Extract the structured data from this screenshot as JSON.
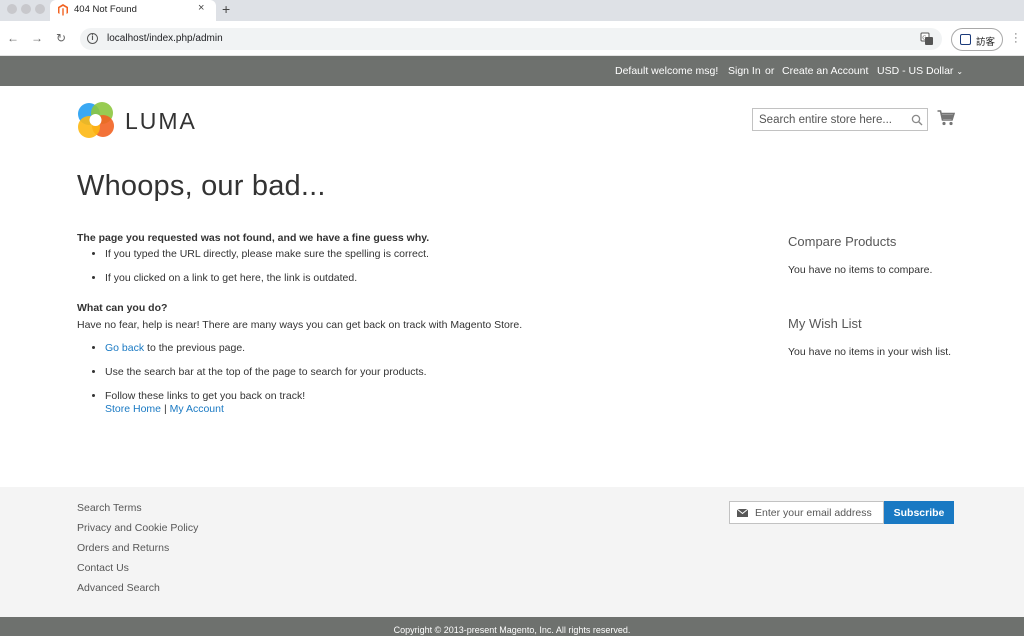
{
  "browser": {
    "tab_title": "404 Not Found",
    "tab_close": "×",
    "new_tab": "+",
    "url": "localhost/index.php/admin",
    "guest_label": "訪客",
    "colors": {
      "tabbar": "#dee1e6",
      "favicon": "#f26322"
    }
  },
  "header_panel": {
    "welcome": "Default welcome msg!",
    "sign_in": "Sign In",
    "or": "or",
    "create_account": "Create an Account",
    "currency": "USD - US Dollar"
  },
  "header": {
    "logo_text": "LUMA",
    "search_placeholder": "Search entire store here..."
  },
  "main": {
    "title": "Whoops, our bad...",
    "intro": "The page you requested was not found, and we have a fine guess why.",
    "reasons": [
      "If you typed the URL directly, please make sure the spelling is correct.",
      "If you clicked on a link to get here, the link is outdated."
    ],
    "what_heading": "What can you do?",
    "help_text": "Have no fear, help is near! There are many ways you can get back on track with Magento Store.",
    "go_back_link": "Go back",
    "go_back_rest": " to the previous page.",
    "search_tip": "Use the search bar at the top of the page to search for your products.",
    "follow_links": "Follow these links to get you back on track!",
    "store_home": "Store Home",
    "separator": "|",
    "my_account": "My Account"
  },
  "sidebar": {
    "compare_title": "Compare Products",
    "compare_text": "You have no items to compare.",
    "wishlist_title": "My Wish List",
    "wishlist_text": "You have no items in your wish list."
  },
  "footer": {
    "links": [
      "Search Terms",
      "Privacy and Cookie Policy",
      "Orders and Returns",
      "Contact Us",
      "Advanced Search"
    ],
    "newsletter_placeholder": "Enter your email address",
    "subscribe_label": "Subscribe",
    "copyright": "Copyright © 2013-present Magento, Inc. All rights reserved."
  },
  "colors": {
    "accent": "#1979c3",
    "panel": "#6e716e",
    "footer_bg": "#f4f4f4"
  }
}
